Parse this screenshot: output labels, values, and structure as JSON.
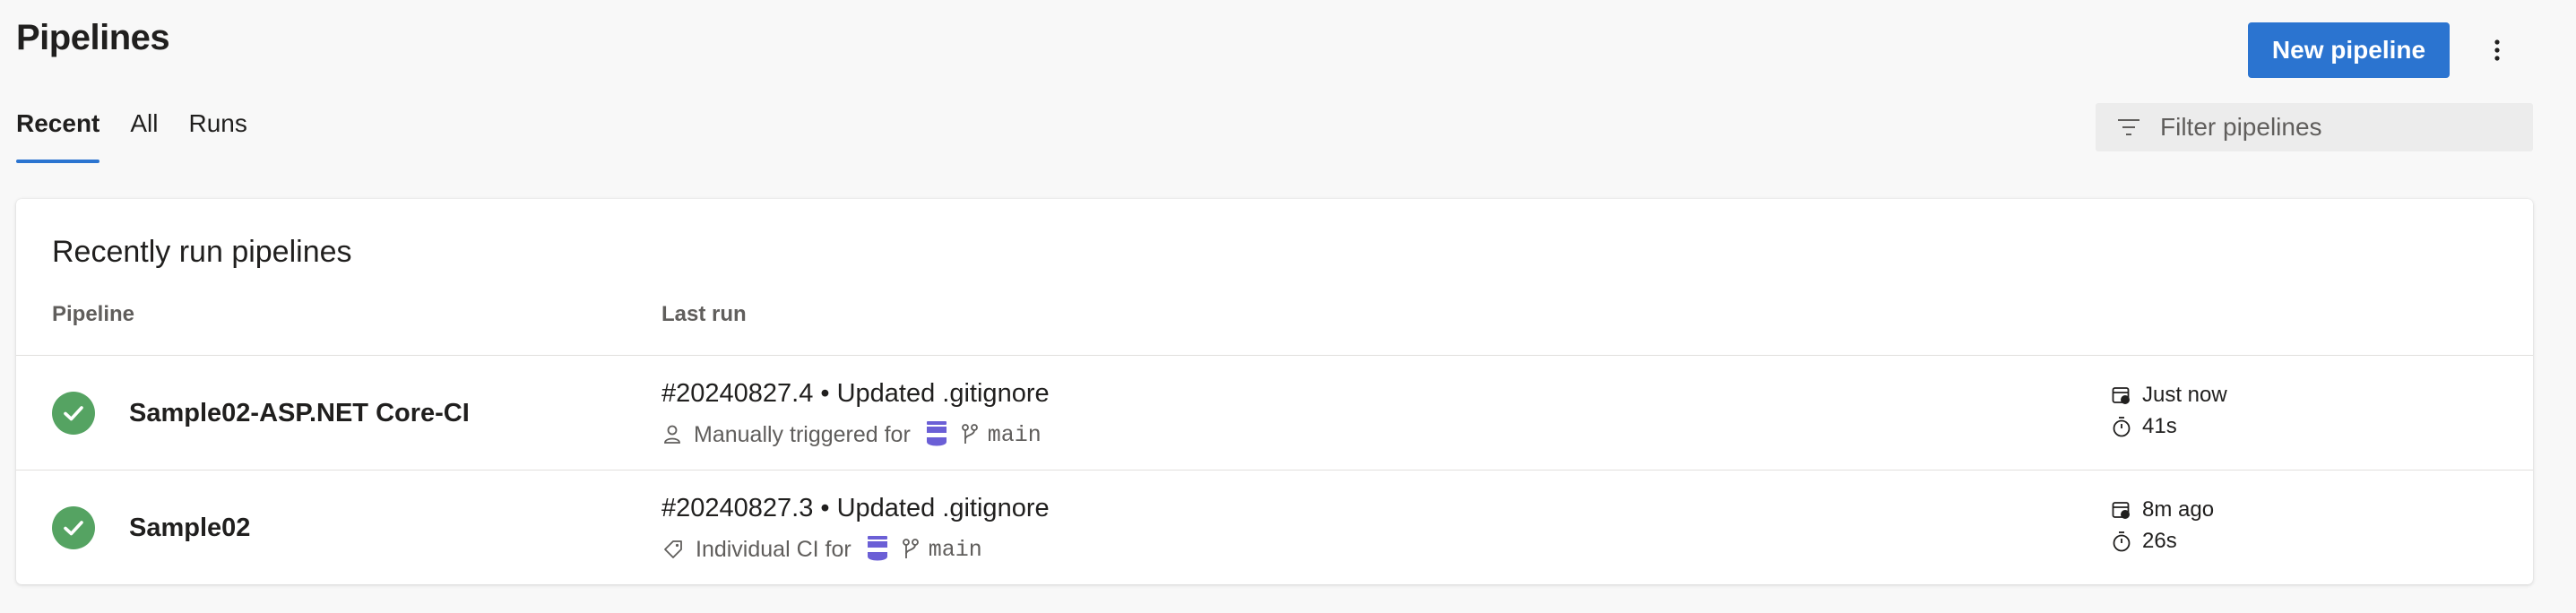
{
  "header": {
    "title": "Pipelines",
    "new_button_label": "New pipeline",
    "more_icon": "more-vertical-icon"
  },
  "tabs": [
    {
      "label": "Recent",
      "active": true
    },
    {
      "label": "All",
      "active": false
    },
    {
      "label": "Runs",
      "active": false
    }
  ],
  "filter": {
    "placeholder": "Filter pipelines",
    "icon": "filter-icon"
  },
  "card": {
    "title": "Recently run pipelines",
    "columns": {
      "pipeline": "Pipeline",
      "last_run": "Last run"
    },
    "rows": [
      {
        "status": "succeeded",
        "name": "Sample02-ASP.NET Core-CI",
        "run_title": "#20240827.4 • Updated .gitignore",
        "trigger_text": "Manually triggered for",
        "trigger_icon": "person-icon",
        "branch": "main",
        "when": "Just now",
        "duration": "41s"
      },
      {
        "status": "succeeded",
        "name": "Sample02",
        "run_title": "#20240827.3 • Updated .gitignore",
        "trigger_text": "Individual CI for",
        "trigger_icon": "tag-icon",
        "branch": "main",
        "when": "8m ago",
        "duration": "26s"
      }
    ]
  },
  "colors": {
    "accent": "#2b74d0",
    "success": "#55a362",
    "avatar": "#6b5fd6"
  }
}
